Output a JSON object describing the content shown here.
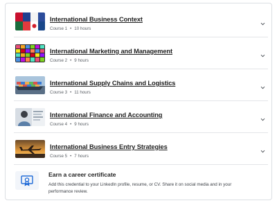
{
  "courses": [
    {
      "title": "International Business Context",
      "course_label": "Course 1",
      "duration": "10 hours",
      "thumb_icon": "business-context-thumbnail"
    },
    {
      "title": "International Marketing and Management",
      "course_label": "Course 2",
      "duration": "9 hours",
      "thumb_icon": "marketing-thumbnail"
    },
    {
      "title": "International Supply Chains and Logistics",
      "course_label": "Course 3",
      "duration": "11 hours",
      "thumb_icon": "supply-chain-thumbnail"
    },
    {
      "title": "International Finance and Accounting",
      "course_label": "Course 4",
      "duration": "9 hours",
      "thumb_icon": "finance-thumbnail"
    },
    {
      "title": "International Business Entry Strategies",
      "course_label": "Course 5",
      "duration": "7 hours",
      "thumb_icon": "airplane-thumbnail"
    }
  ],
  "certificate": {
    "title": "Earn a career certificate",
    "description": "Add this credential to your LinkedIn profile, resume, or CV. Share it on social media and in your performance review.",
    "icon": "certificate-icon"
  },
  "colors": {
    "divider": "#e3e5e8",
    "meta_text": "#5b6066",
    "icon_blue": "#0056d2"
  }
}
